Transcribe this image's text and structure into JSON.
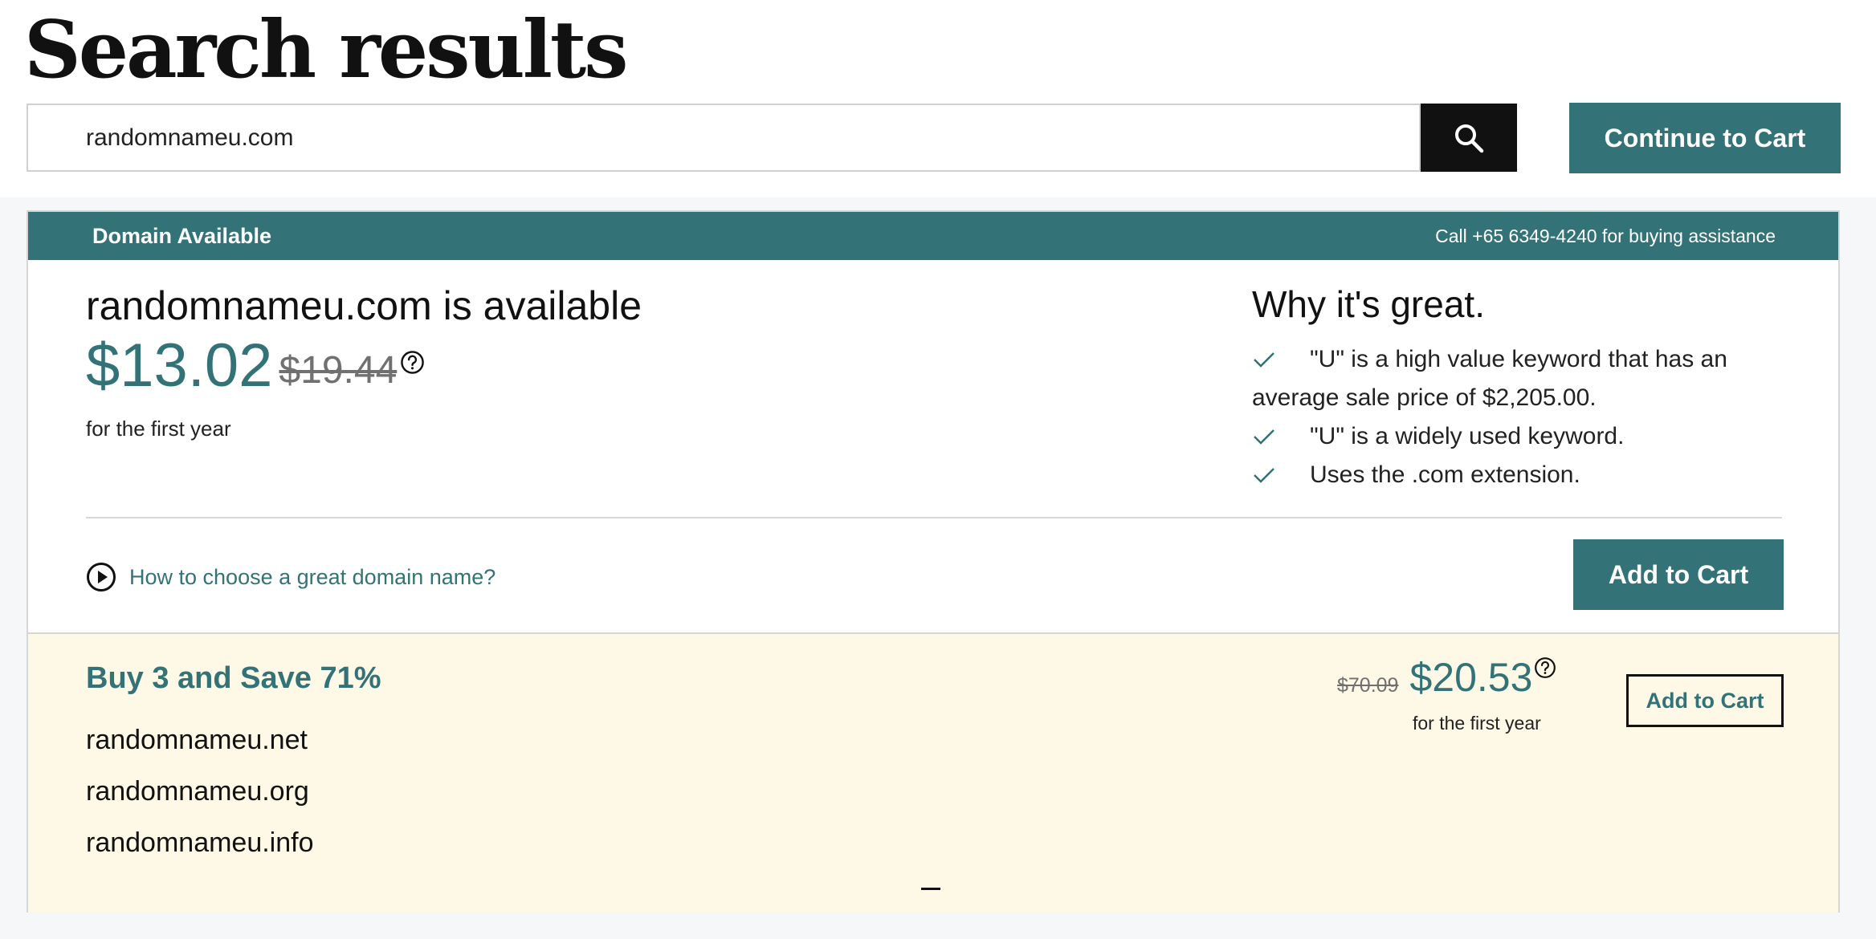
{
  "page": {
    "title": "Search results"
  },
  "search": {
    "value": "randomnameu.com",
    "button_icon": "search-icon"
  },
  "header": {
    "continue_label": "Continue to Cart"
  },
  "banner": {
    "status": "Domain Available",
    "assistance": "Call +65 6349-4240 for buying assistance"
  },
  "result": {
    "headline": "randomnameu.com is available",
    "price": "$13.02",
    "old_price": "$19.44",
    "period": "for the first year",
    "help_icon": "question-circle-icon"
  },
  "why": {
    "title": "Why it's great.",
    "items": [
      "\"U\" is a high value keyword that has an average sale price of $2,205.00.",
      "\"U\" is a widely used keyword.",
      "Uses the .com extension."
    ]
  },
  "footer_row": {
    "how_link": "How to choose a great domain name?",
    "add_label": "Add to Cart"
  },
  "bundle": {
    "title": "Buy 3 and Save 71%",
    "domains": [
      "randomnameu.net",
      "randomnameu.org",
      "randomnameu.info"
    ],
    "old_price": "$70.09",
    "price": "$20.53",
    "period": "for the first year",
    "add_label": "Add to Cart"
  },
  "colors": {
    "accent": "#337377",
    "bundle_bg": "#fef9e6",
    "dark": "#111111"
  }
}
